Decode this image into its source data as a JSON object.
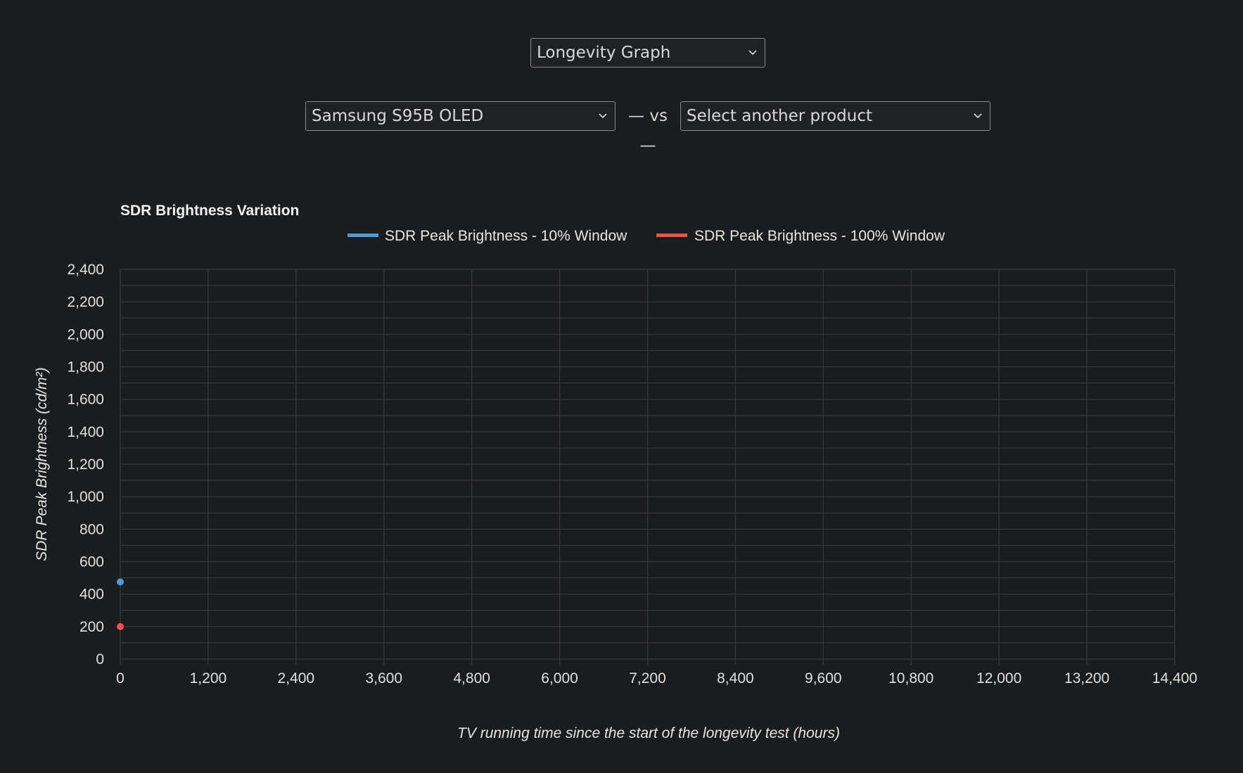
{
  "controls": {
    "graph_type": "Longevity Graph",
    "product_a": "Samsung S95B OLED",
    "vs_label": "— vs —",
    "product_b": "Select another product"
  },
  "icons": {
    "dropdown": "chevron-down-icon"
  },
  "colors": {
    "series_10": "#4f9ad0",
    "series_100": "#e8534b",
    "background": "#1b1c1e",
    "grid": "#3a3b3e"
  },
  "chart_data": {
    "type": "scatter",
    "title": "SDR Brightness Variation",
    "xlabel": "TV running time since the start of the longevity test (hours)",
    "ylabel": "SDR Peak Brightness (cd/m²)",
    "xlim": [
      0,
      14400
    ],
    "ylim": [
      0,
      2400
    ],
    "x_ticks": [
      0,
      1200,
      2400,
      3600,
      4800,
      6000,
      7200,
      8400,
      9600,
      10800,
      12000,
      13200,
      14400
    ],
    "y_ticks": [
      0,
      200,
      400,
      600,
      800,
      1000,
      1200,
      1400,
      1600,
      1800,
      2000,
      2200,
      2400
    ],
    "x_tick_labels": [
      "0",
      "1,200",
      "2,400",
      "3,600",
      "4,800",
      "6,000",
      "7,200",
      "8,400",
      "9,600",
      "10,800",
      "12,000",
      "13,200",
      "14,400"
    ],
    "y_tick_labels": [
      "0",
      "200",
      "400",
      "600",
      "800",
      "1,000",
      "1,200",
      "1,400",
      "1,600",
      "1,800",
      "2,000",
      "2,200",
      "2,400"
    ],
    "grid": true,
    "legend_position": "top",
    "series": [
      {
        "name": "SDR Peak Brightness - 10% Window",
        "color": "#4f9ad0",
        "points": [
          [
            0,
            475
          ]
        ]
      },
      {
        "name": "SDR Peak Brightness - 100% Window",
        "color": "#e8534b",
        "points": [
          [
            0,
            200
          ]
        ]
      }
    ]
  }
}
